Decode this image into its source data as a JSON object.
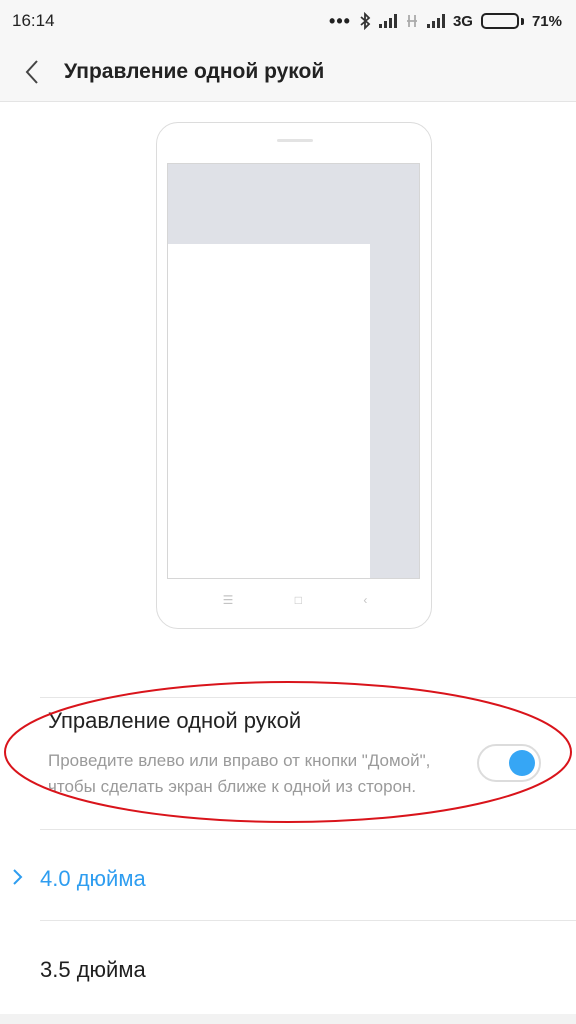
{
  "status_bar": {
    "time": "16:14",
    "network_type": "3G",
    "battery_percent": "71%",
    "battery_level": 0.71,
    "icons": [
      "more-dots-icon",
      "bluetooth-icon",
      "signal-icon",
      "no-signal-icon",
      "signal-icon",
      "battery-icon"
    ]
  },
  "header": {
    "title": "Управление одной рукой",
    "back_icon": "chevron-left-icon"
  },
  "setting": {
    "title": "Управление одной рукой",
    "description": "Проведите влево или вправо от кнопки \"Домой\", чтобы сделать экран ближе к одной из сторон.",
    "enabled": true,
    "accent_color": "#36a6f5"
  },
  "options": [
    {
      "label": "4.0 дюйма",
      "selected": true
    },
    {
      "label": "3.5 дюйма",
      "selected": false
    }
  ],
  "colors": {
    "selected": "#2e9df0",
    "highlight_ellipse": "#d9141b"
  }
}
